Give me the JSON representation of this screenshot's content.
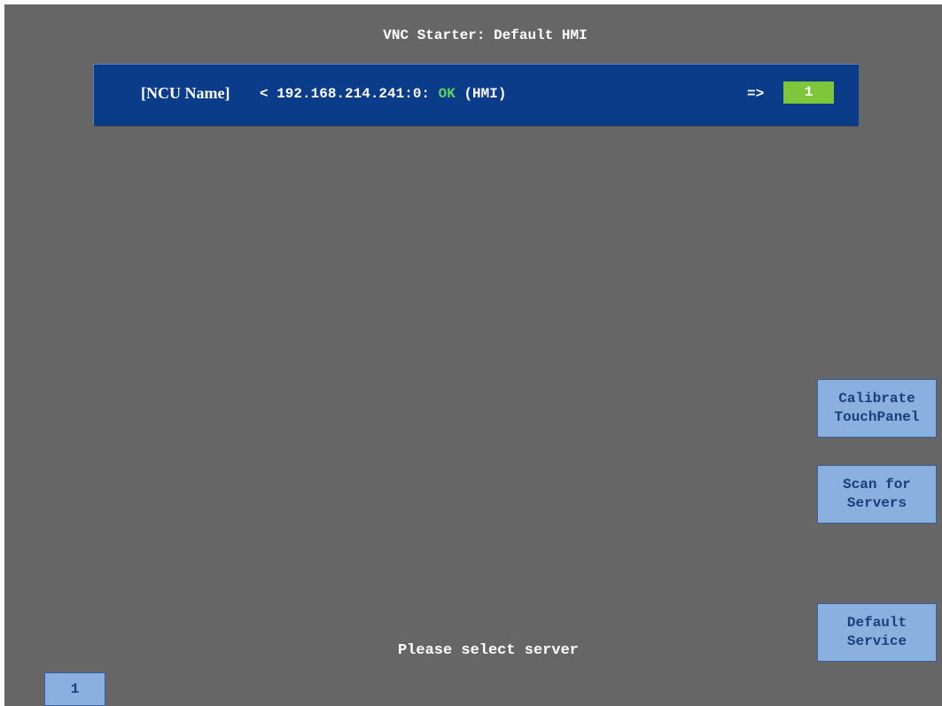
{
  "header": {
    "title": "VNC Starter: Default HMI"
  },
  "servers": [
    {
      "ncu_name": "[NCU Name]",
      "address_prefix": "< 192.168.214.241:0: ",
      "status": "OK",
      "type": " (HMI)",
      "arrow": "=>",
      "screen_number": "1"
    }
  ],
  "side_buttons": {
    "calibrate": {
      "line1": "Calibrate",
      "line2": "TouchPanel"
    },
    "scan": {
      "line1": "Scan for",
      "line2": "Servers"
    },
    "default_service": {
      "line1": "Default",
      "line2": "Service"
    }
  },
  "status_message": "Please select server",
  "page_tab": "1",
  "colors": {
    "background": "#666666",
    "row_background": "#0a3c8a",
    "status_ok": "#5cd65c",
    "screen_number_bg": "#7ec63a",
    "button_bg": "#8ab0e0",
    "button_text": "#1a3f7a"
  }
}
